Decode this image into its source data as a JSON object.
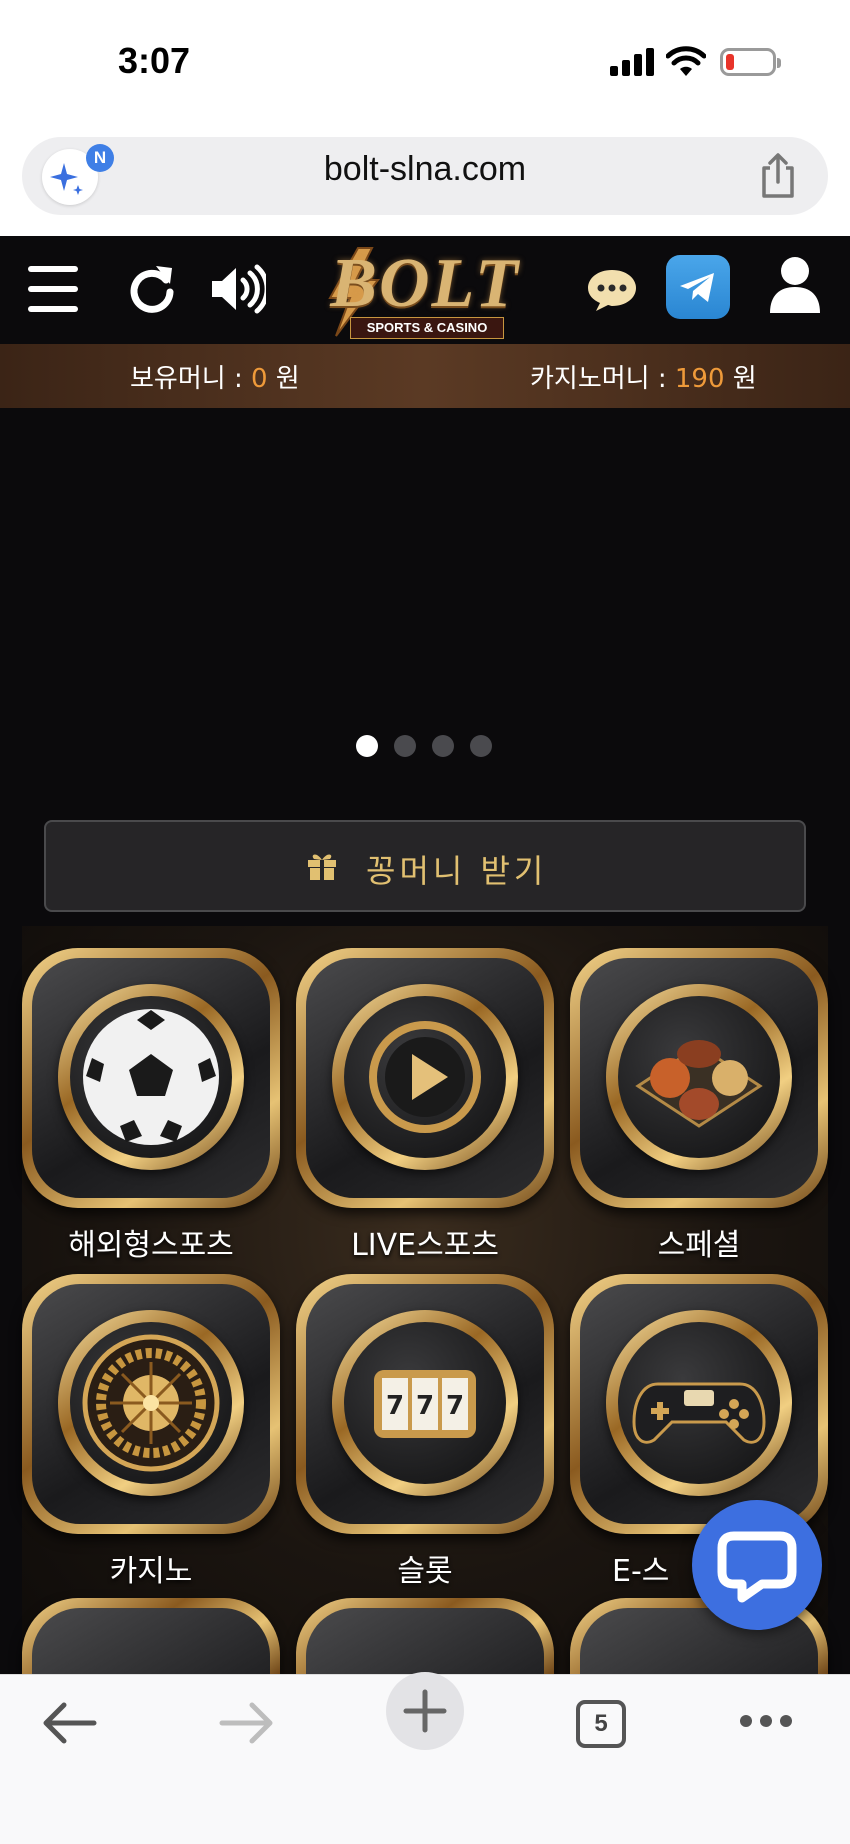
{
  "status_bar": {
    "time": "3:07"
  },
  "browser": {
    "url": "bolt-slna.com",
    "ai_badge_letter": "N",
    "open_tabs_count": "5"
  },
  "site": {
    "logo_text": "BOLT",
    "logo_subtitle": "SPORTS & CASINO",
    "header_icons": [
      "menu-icon",
      "refresh-icon",
      "sound-icon",
      "chat-bubble-icon",
      "telegram-icon",
      "user-icon"
    ]
  },
  "money": {
    "hold_label": "보유머니 : ",
    "hold_value": "0",
    "hold_unit": " 원",
    "casino_label": "카지노머니 : ",
    "casino_value": "190",
    "casino_unit": " 원"
  },
  "banner": {
    "slide_count": 4,
    "active_slide": 1
  },
  "point_button": {
    "label": "꽁머니 받기"
  },
  "games": [
    {
      "label": "해외형스포츠",
      "icon": "soccer-ball-icon"
    },
    {
      "label": "LIVE스포츠",
      "icon": "play-icon"
    },
    {
      "label": "스페셜",
      "icon": "sports-balls-icon"
    },
    {
      "label": "카지노",
      "icon": "roulette-icon"
    },
    {
      "label": "슬롯",
      "icon": "slot-machine-icon"
    },
    {
      "label": "E-스",
      "icon": "gamepad-icon"
    }
  ],
  "colors": {
    "accent_gold": "#e1c071",
    "money_value": "#ee9a3a",
    "chat_fab": "#3d6fe0",
    "telegram": "#2a86d2"
  }
}
